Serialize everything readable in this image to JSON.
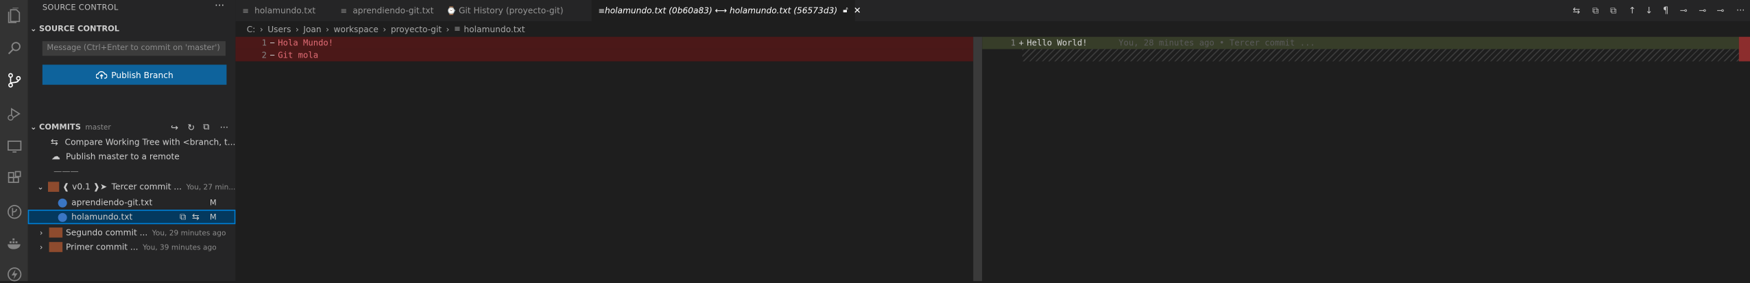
{
  "sidebar": {
    "title": "SOURCE CONTROL",
    "more": "···",
    "scm_header": "SOURCE CONTROL",
    "commit_placeholder": "Message (Ctrl+Enter to commit on 'master')",
    "publish_label": "Publish Branch"
  },
  "commits": {
    "header": "COMMITS",
    "branch": "master",
    "compare": "Compare Working Tree with <branch, t...",
    "publish": "Publish master to a remote",
    "separator": "———",
    "items": [
      {
        "tag": "❰ v0.1 ❱➤",
        "title": "Tercer commit ...",
        "meta": "You, 27 min..."
      },
      {
        "title": "Segundo commit ...",
        "meta": "You, 29 minutes ago"
      },
      {
        "title": "Primer commit ...",
        "meta": "You, 39 minutes ago"
      }
    ],
    "files": [
      {
        "name": "aprendiendo-git.txt",
        "status": "M"
      },
      {
        "name": "holamundo.txt",
        "status": "M"
      }
    ]
  },
  "tabs": [
    {
      "label": "holamundo.txt"
    },
    {
      "label": "aprendiendo-git.txt"
    },
    {
      "label": "Git History (proyecto-git)"
    },
    {
      "label": "holamundo.txt (0b60a83) ⟷ holamundo.txt (56573d3)"
    }
  ],
  "breadcrumb": [
    "C:",
    "Users",
    "Joan",
    "workspace",
    "proyecto-git",
    "holamundo.txt"
  ],
  "diff": {
    "left": [
      {
        "num": "1",
        "mark": "−",
        "text": "Hola Mundo!"
      },
      {
        "num": "2",
        "mark": "−",
        "text": "Git mola"
      }
    ],
    "right": [
      {
        "num": "1",
        "mark": "+",
        "text": "Hello World!",
        "blame": "You, 28 minutes ago • Tercer commit ..."
      }
    ]
  },
  "colors": {
    "accent": "#0e639c",
    "deleted": "#4b1818",
    "added": "#373d29",
    "activity": "#333333"
  }
}
